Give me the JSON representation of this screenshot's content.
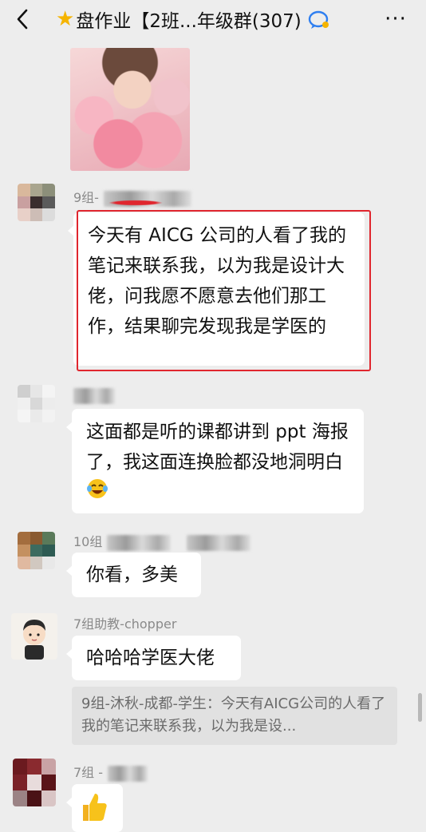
{
  "header": {
    "title": "盘作业【2班...年级群(307)",
    "back_icon": "back-chevron-icon",
    "more_label": "···"
  },
  "messages": [
    {
      "sender": "",
      "type": "image"
    },
    {
      "sender": "9组-",
      "text": "今天有 AICG 公司的人看了我的笔记来联系我，以为我是设计大佬，问我愿不愿意去他们那工作，结果聊完发现我是学医的",
      "highlight_color": "#e0262e"
    },
    {
      "sender": "",
      "text": "这面都是听的课都讲到 ppt 海报了，我这面连换脸都没地洞明白",
      "emoji": "laughing-crying-icon"
    },
    {
      "sender": "10组",
      "text": "你看，多美"
    },
    {
      "sender": "7组助教-chopper",
      "text": "哈哈哈学医大佬"
    },
    {
      "sender": "7组 -",
      "emoji": "thumbs-up-icon"
    }
  ],
  "quote": {
    "text": "9组-沐秋-成都-学生：今天有AICG公司的人看了我的笔记来联系我，以为我是设..."
  },
  "colors": {
    "background": "#ededed",
    "bubble": "#ffffff",
    "highlight": "#e0262e",
    "star": "#f5b400"
  }
}
